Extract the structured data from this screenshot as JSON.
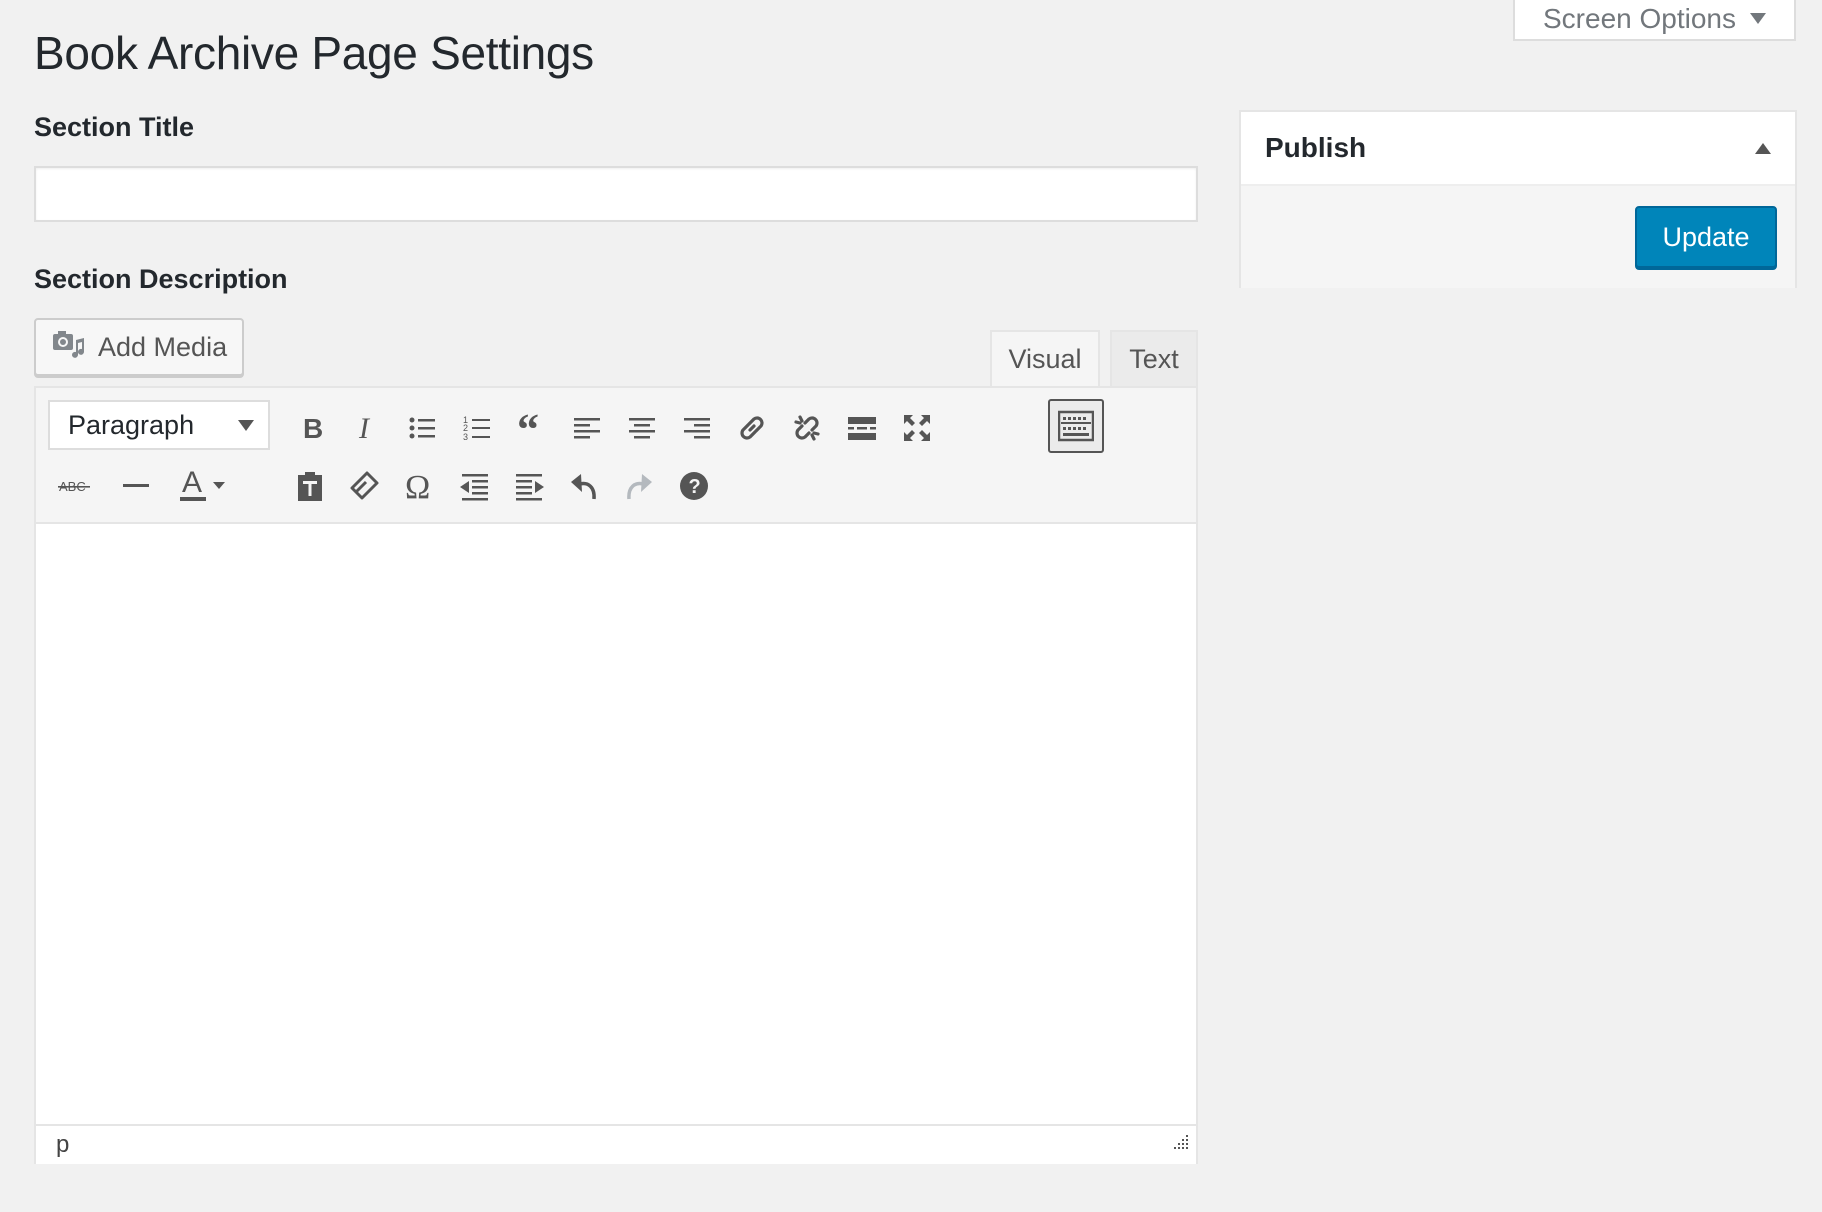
{
  "screen_options": {
    "label": "Screen Options"
  },
  "page": {
    "title": "Book Archive Page Settings"
  },
  "section_title": {
    "label": "Section Title",
    "value": ""
  },
  "section_description": {
    "label": "Section Description",
    "add_media_label": "Add Media",
    "tabs": [
      {
        "label": "Visual",
        "active": true
      },
      {
        "label": "Text",
        "active": false
      }
    ],
    "format_select": {
      "value": "Paragraph"
    },
    "toolbar_row1": [
      "bold",
      "italic",
      "bulleted-list",
      "numbered-list",
      "blockquote",
      "align-left",
      "align-center",
      "align-right",
      "insert-link",
      "remove-link",
      "read-more",
      "fullscreen",
      "toolbar-toggle"
    ],
    "toolbar_row2": [
      "strikethrough",
      "horizontal-line",
      "text-color",
      "paste-as-text",
      "clear-formatting",
      "special-character",
      "decrease-indent",
      "increase-indent",
      "undo",
      "redo",
      "keyboard-shortcuts"
    ],
    "status_path": "p"
  },
  "publish": {
    "title": "Publish",
    "update_label": "Update"
  },
  "colors": {
    "primary_button": "#0085ba",
    "background": "#f1f1f1"
  }
}
